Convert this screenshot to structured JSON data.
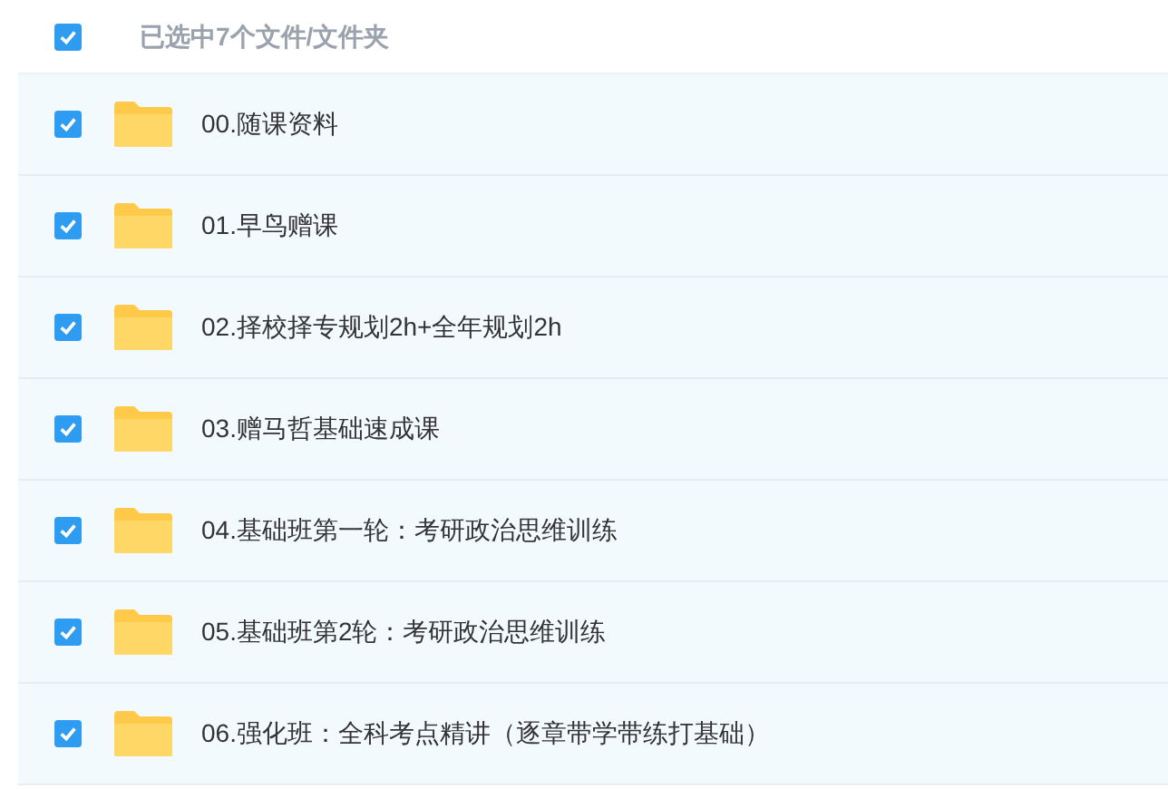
{
  "header": {
    "checked": true,
    "label": "已选中7个文件/文件夹"
  },
  "items": [
    {
      "name": "00.随课资料",
      "checked": true
    },
    {
      "name": "01.早鸟赠课",
      "checked": true
    },
    {
      "name": "02.择校择专规划2h+全年规划2h",
      "checked": true
    },
    {
      "name": "03.赠马哲基础速成课",
      "checked": true
    },
    {
      "name": "04.基础班第一轮：考研政治思维训练",
      "checked": true
    },
    {
      "name": "05.基础班第2轮：考研政治思维训练",
      "checked": true
    },
    {
      "name": "06.强化班：全科考点精讲（逐章带学带练打基础）",
      "checked": true
    }
  ]
}
